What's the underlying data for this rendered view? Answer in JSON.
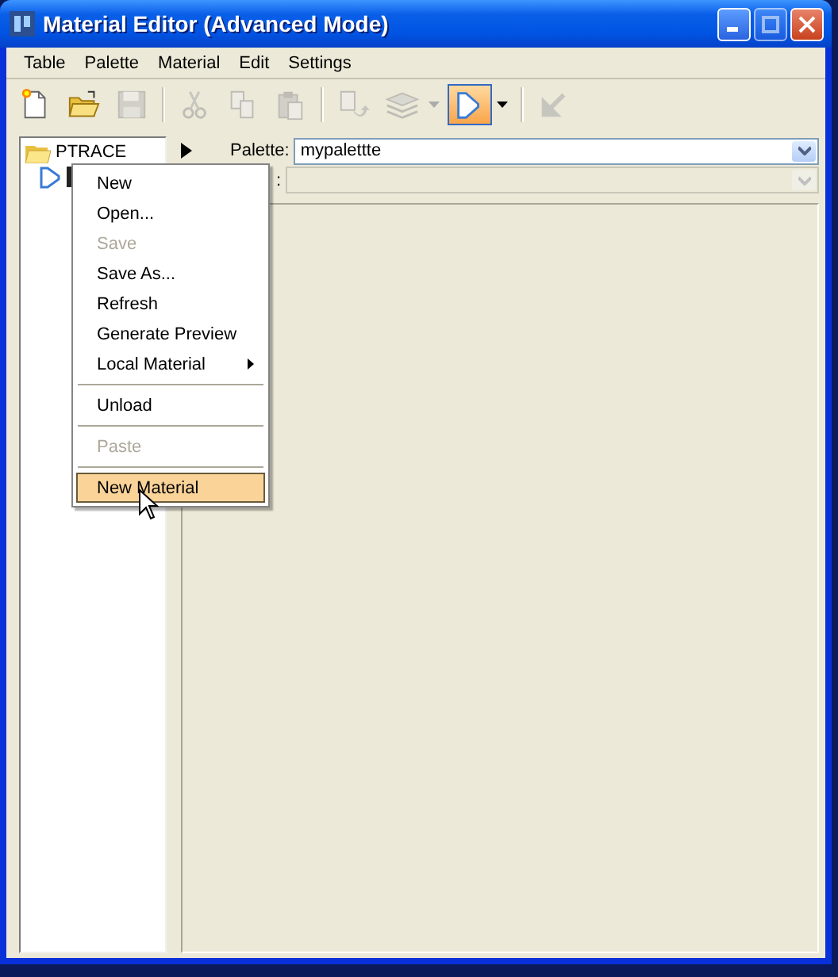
{
  "window": {
    "title": "Material Editor (Advanced Mode)"
  },
  "menu_bar": [
    {
      "label": "Table"
    },
    {
      "label": "Palette"
    },
    {
      "label": "Material"
    },
    {
      "label": "Edit"
    },
    {
      "label": "Settings"
    }
  ],
  "toolbar": [
    {
      "kind": "button",
      "disabled": false
    },
    {
      "kind": "button",
      "disabled": false
    },
    {
      "kind": "button",
      "disabled": true
    },
    {
      "kind": "separator"
    },
    {
      "kind": "button",
      "disabled": true
    },
    {
      "kind": "button",
      "disabled": true
    },
    {
      "kind": "button",
      "disabled": true
    },
    {
      "kind": "separator"
    },
    {
      "kind": "button",
      "disabled": true
    },
    {
      "kind": "dropdown",
      "disabled": true,
      "pressed": false
    },
    {
      "kind": "dropdown",
      "disabled": false,
      "pressed": true
    },
    {
      "kind": "separator"
    },
    {
      "kind": "button",
      "disabled": true
    }
  ],
  "tree": [
    {
      "label": "PTRACE",
      "children": [
        {
          "selected": true
        }
      ]
    }
  ],
  "palette_field": {
    "label": "Palette:",
    "value": "mypalettte"
  },
  "second_field": {
    "label": ":",
    "disabled": true
  },
  "context_menu": [
    {
      "kind": "item",
      "label": "New",
      "disabled": false,
      "selected": false
    },
    {
      "kind": "item",
      "label": "Open...",
      "disabled": false,
      "selected": false
    },
    {
      "kind": "item",
      "label": "Save",
      "disabled": true,
      "selected": false
    },
    {
      "kind": "item",
      "label": "Save As...",
      "disabled": false,
      "selected": false
    },
    {
      "kind": "item",
      "label": "Refresh",
      "disabled": false,
      "selected": false
    },
    {
      "kind": "item",
      "label": "Generate Preview",
      "disabled": false,
      "selected": false
    },
    {
      "kind": "submenu",
      "label": "Local Material",
      "disabled": false,
      "selected": false
    },
    {
      "kind": "separator"
    },
    {
      "kind": "item",
      "label": "Unload",
      "disabled": false,
      "selected": false
    },
    {
      "kind": "separator"
    },
    {
      "kind": "item",
      "label": "Paste",
      "disabled": true,
      "selected": false
    },
    {
      "kind": "separator"
    },
    {
      "kind": "item",
      "label": "New Material",
      "disabled": false,
      "selected": true
    }
  ]
}
